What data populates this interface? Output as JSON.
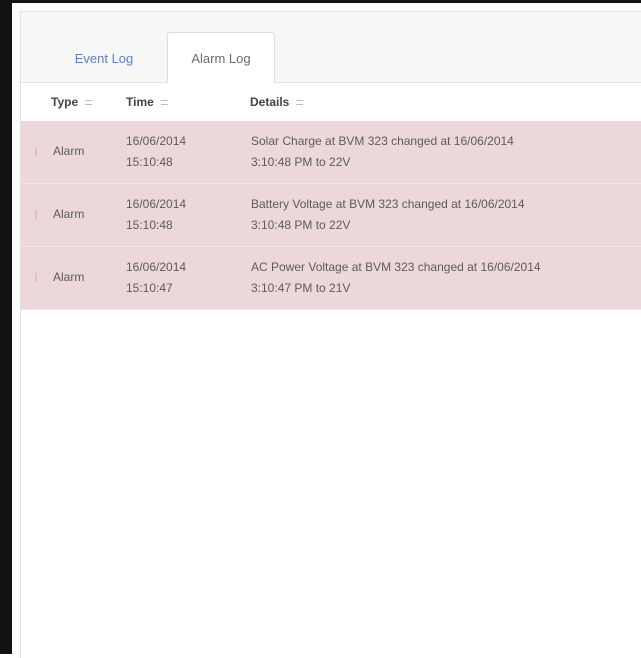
{
  "tabs": {
    "event_log": "Event Log",
    "alarm_log": "Alarm Log"
  },
  "columns": {
    "type": "Type",
    "time": "Time",
    "details": "Details"
  },
  "rows": [
    {
      "type": "Alarm",
      "date": "16/06/2014",
      "time": "15:10:48",
      "details_line1": "Solar Charge at BVM 323 changed at 16/06/2014",
      "details_line2": "3:10:48 PM to 22V"
    },
    {
      "type": "Alarm",
      "date": "16/06/2014",
      "time": "15:10:48",
      "details_line1": "Battery Voltage at BVM 323 changed at 16/06/2014",
      "details_line2": "3:10:48 PM to 22V"
    },
    {
      "type": "Alarm",
      "date": "16/06/2014",
      "time": "15:10:47",
      "details_line1": "AC Power Voltage at BVM 323 changed at 16/06/2014",
      "details_line2": "3:10:47 PM to 21V"
    }
  ],
  "colors": {
    "alarm_row": "#ecd7db",
    "active_tab_link": "#5b7fc7"
  }
}
